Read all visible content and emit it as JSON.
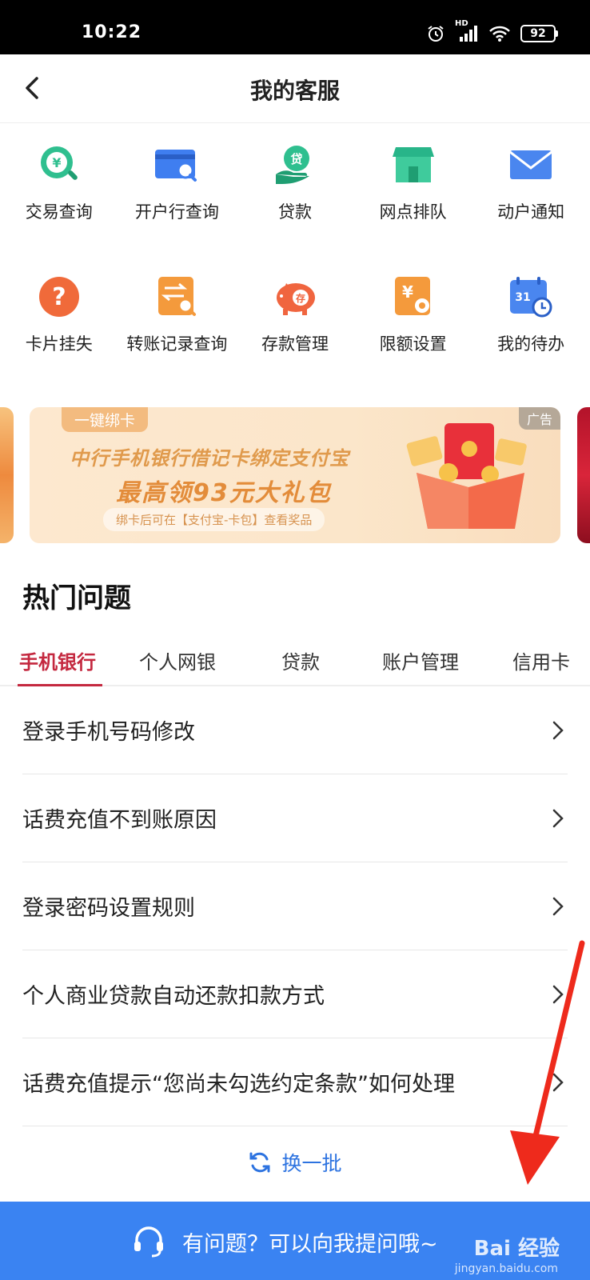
{
  "status_bar": {
    "time": "10:22",
    "battery": "92",
    "network": "HD"
  },
  "header": {
    "title": "我的客服"
  },
  "services_row1": [
    {
      "label": "交易查询",
      "icon": "transaction-search-icon"
    },
    {
      "label": "开户行查询",
      "icon": "bank-card-search-icon"
    },
    {
      "label": "贷款",
      "icon": "loan-hand-icon"
    },
    {
      "label": "网点排队",
      "icon": "branch-store-icon"
    },
    {
      "label": "动户通知",
      "icon": "mail-envelope-icon"
    }
  ],
  "services_row2": [
    {
      "label": "卡片挂失",
      "icon": "question-mark-icon"
    },
    {
      "label": "转账记录查询",
      "icon": "transfer-record-icon"
    },
    {
      "label": "存款管理",
      "icon": "piggy-bank-icon"
    },
    {
      "label": "限额设置",
      "icon": "limit-setting-icon"
    },
    {
      "label": "我的待办",
      "icon": "calendar-clock-icon"
    }
  ],
  "banner": {
    "tag": "一键绑卡",
    "ad_label": "广告",
    "line1": "中行手机银行借记卡绑定支付宝",
    "line2": "最高领93元大礼包",
    "line3": "绑卡后可在【支付宝-卡包】查看奖品"
  },
  "hot": {
    "title": "热门问题",
    "tabs": [
      "手机银行",
      "个人网银",
      "贷款",
      "账户管理",
      "信用卡"
    ],
    "active_tab": "手机银行",
    "questions": [
      "登录手机号码修改",
      "话费充值不到账原因",
      "登录密码设置规则",
      "个人商业贷款自动还款扣款方式",
      "话费充值提示“您尚未勾选约定条款”如何处理"
    ],
    "refresh_label": "换一批"
  },
  "bottom": {
    "label": "有问题？可以向我提问哦~"
  },
  "watermark": {
    "text": "Bai 经验",
    "url": "jingyan.baidu.com"
  },
  "colors": {
    "accent": "#c4283f",
    "blue": "#3a83f2",
    "link": "#2d73e0"
  }
}
